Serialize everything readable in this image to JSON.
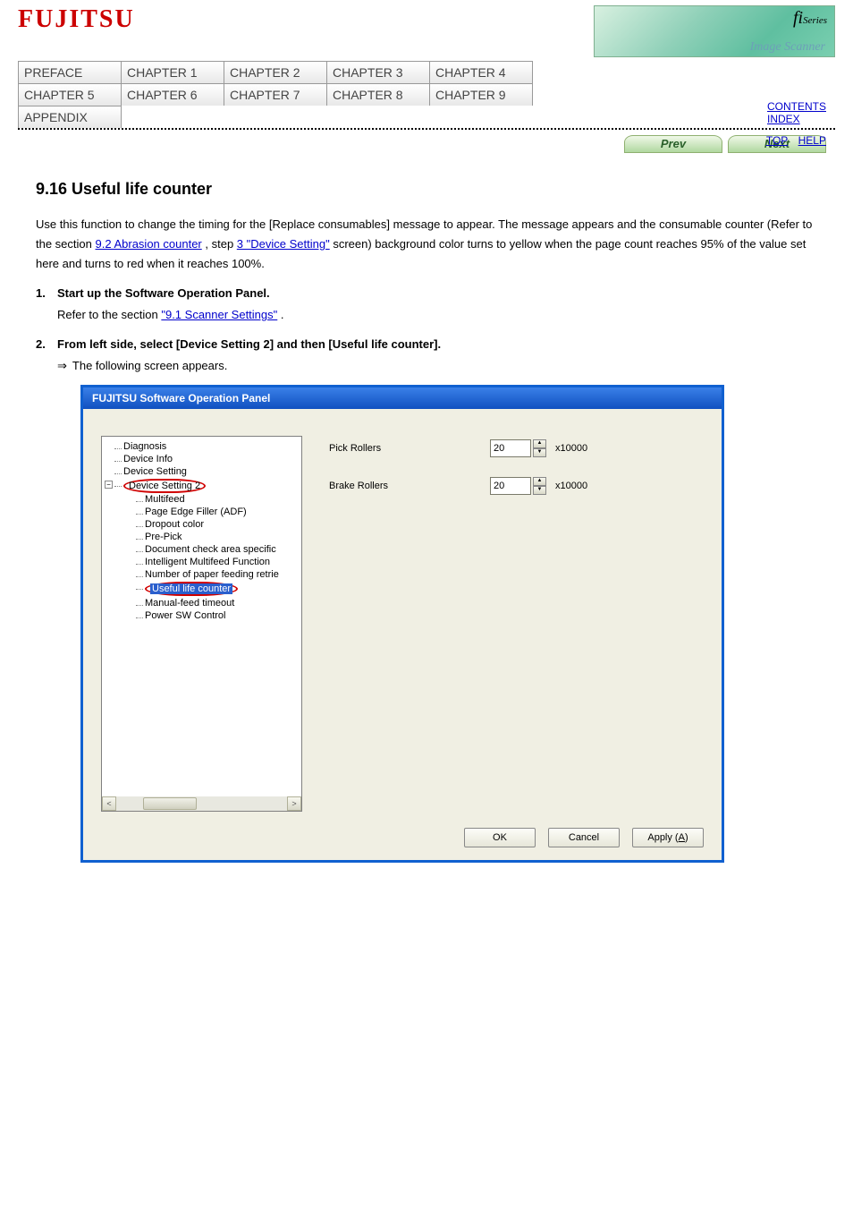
{
  "header": {
    "logo_text": "FUJITSU",
    "banner_fi": "fi",
    "banner_series": "Series",
    "banner_sub": "Image Scanner"
  },
  "top_right_links": {
    "contents": "CONTENTS",
    "index": "INDEX"
  },
  "chapter_tabs": {
    "row1": [
      "PREFACE",
      "CHAPTER 1",
      "CHAPTER 2",
      "CHAPTER 3",
      "CHAPTER 4"
    ],
    "row2": [
      "CHAPTER 5",
      "CHAPTER 6",
      "CHAPTER 7",
      "CHAPTER 8",
      "CHAPTER 9"
    ],
    "row3": [
      "APPENDIX"
    ]
  },
  "help_links": {
    "top": "TOP",
    "help": "HELP"
  },
  "pager": {
    "prev": "Prev",
    "next": "Next"
  },
  "section": {
    "title": "9.16 Useful life counter",
    "para1_pre": "Use this function to change the timing for the [Replace consumables] message to appear. The message appears and the consumable counter (Refer to the section ",
    "para1_link1": "9.2 Abrasion counter",
    "para1_mid": ", step ",
    "para1_link2": "3 \"Device Setting\"",
    "para1_post": " screen) background color turns to yellow when the page count reaches 95% of the value set here and turns to red when it reaches 100%."
  },
  "steps": {
    "s1_num": "1.",
    "s1_text": "Start up the Software Operation Panel.",
    "s1_ref_pre": "Refer to the section ",
    "s1_ref_link": "\"9.1 Scanner Settings\"",
    "s1_ref_post": ".",
    "s2_num": "2.",
    "s2_text": "From left side, select [Device Setting 2] and then [Useful life counter].",
    "s2_arrow_text": "The following screen appears.",
    "s2_arrow_symbol": "⇒"
  },
  "dialog": {
    "title": "FUJITSU Software Operation Panel",
    "tree": {
      "n0": "Diagnosis",
      "n1": "Device Info",
      "n2": "Device Setting",
      "n3": "Device Setting 2",
      "c0": "Multifeed",
      "c1": "Page Edge Filler (ADF)",
      "c2": "Dropout color",
      "c3": "Pre-Pick",
      "c4": "Document check area specific",
      "c5": "Intelligent Multifeed Function",
      "c6": "Number of paper feeding retrie",
      "c7": "Useful life counter",
      "c8": "Manual-feed timeout",
      "c9": "Power SW Control"
    },
    "right": {
      "pick_label": "Pick Rollers",
      "pick_value": "20",
      "brake_label": "Brake Rollers",
      "brake_value": "20",
      "multiplier": "x10000"
    },
    "buttons": {
      "ok": "OK",
      "cancel": "Cancel",
      "apply": "Apply (A)",
      "apply_underline_char": "A"
    },
    "expander": "−",
    "scroll_left": "<",
    "scroll_right": ">",
    "spin_up": "▲",
    "spin_down": "▼"
  }
}
